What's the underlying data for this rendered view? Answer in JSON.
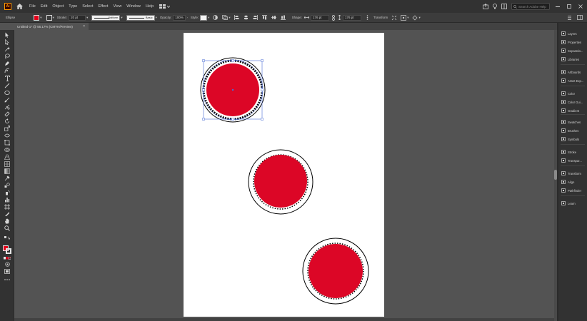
{
  "app": {
    "logo": "Ai"
  },
  "menu": {
    "items": [
      "File",
      "Edit",
      "Object",
      "Type",
      "Select",
      "Effect",
      "View",
      "Window",
      "Help"
    ],
    "search_placeholder": "Search Adobe Help"
  },
  "control_bar": {
    "selection_label": "Ellipse",
    "stroke_label": "Stroke:",
    "stroke_weight": "20 pt",
    "profile_label": "Uniform",
    "brush_label": "Basic",
    "opacity_label": "Opacity:",
    "opacity_value": "100%",
    "style_label": "Style:",
    "shape_label": "Shape:",
    "width_value": "176 pt",
    "height_value": "176 pt",
    "transform_label": "Transform",
    "fill_color": "#e3001b"
  },
  "document": {
    "tab_title": "Untitled-1* @ 56.17% (CMYK/Preview)",
    "close_glyph": "×"
  },
  "artwork": {
    "fill_color": "#dc0626",
    "stroke_color": "#000000",
    "selection_color": "#4a6cd4"
  },
  "panels": [
    {
      "label": "Layers",
      "icon": "layers-icon"
    },
    {
      "label": "Properties",
      "icon": "properties-icon"
    },
    {
      "label": "Separatio...",
      "icon": "separations-icon"
    },
    {
      "label": "Libraries",
      "icon": "libraries-icon"
    },
    {
      "label": "Artboards",
      "icon": "artboards-icon"
    },
    {
      "label": "Asset Exp...",
      "icon": "asset-export-icon"
    },
    {
      "label": "Color",
      "icon": "color-icon"
    },
    {
      "label": "Color Gui...",
      "icon": "color-guide-icon"
    },
    {
      "label": "Gradient",
      "icon": "gradient-icon"
    },
    {
      "label": "Swatches",
      "icon": "swatches-icon"
    },
    {
      "label": "Brushes",
      "icon": "brushes-icon"
    },
    {
      "label": "Symbols",
      "icon": "symbols-icon"
    },
    {
      "label": "Stroke",
      "icon": "stroke-icon"
    },
    {
      "label": "Transpar...",
      "icon": "transparency-icon"
    },
    {
      "label": "Transform",
      "icon": "transform-icon"
    },
    {
      "label": "Align",
      "icon": "align-icon"
    },
    {
      "label": "Pathfinder",
      "icon": "pathfinder-icon"
    },
    {
      "label": "Learn",
      "icon": "learn-icon"
    }
  ]
}
